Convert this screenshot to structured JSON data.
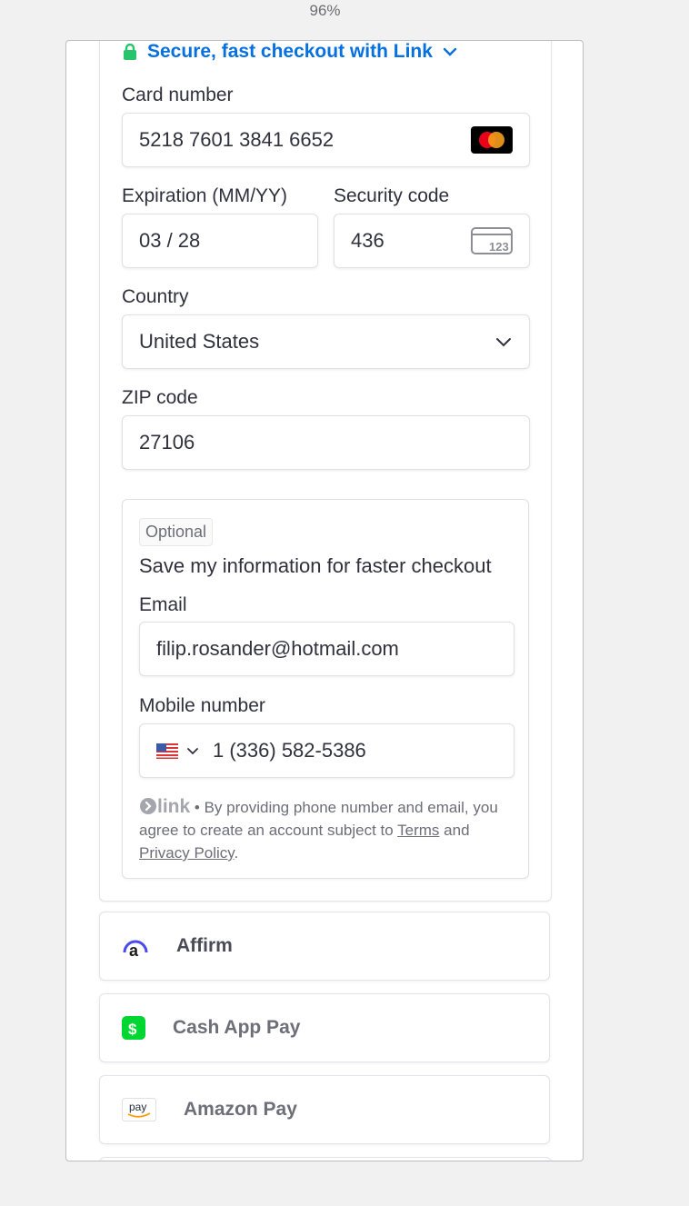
{
  "browser": {
    "zoom": "96%"
  },
  "link": {
    "banner": "Secure, fast checkout with Link"
  },
  "card": {
    "number_label": "Card number",
    "number_value": "5218 7601 3841 6652",
    "expiry_label": "Expiration (MM/YY)",
    "expiry_value": "03 / 28",
    "cvc_label": "Security code",
    "cvc_value": "436",
    "cvc_icon_text": "123",
    "country_label": "Country",
    "country_value": "United States",
    "zip_label": "ZIP code",
    "zip_value": "27106"
  },
  "save": {
    "optional": "Optional",
    "title": "Save my information for faster checkout",
    "email_label": "Email",
    "email_value": "filip.rosander@hotmail.com",
    "mobile_label": "Mobile number",
    "mobile_value": "1 (336) 582-5386",
    "legal_brand": "link",
    "legal_prefix": " • By providing phone number and email, you agree to create an account subject to ",
    "terms": "Terms",
    "and": " and ",
    "privacy": "Privacy Policy",
    "end": "."
  },
  "payment_methods": [
    {
      "name": "Affirm",
      "icon": "affirm-icon"
    },
    {
      "name": "Cash App Pay",
      "icon": "cash-app-icon"
    },
    {
      "name": "Amazon Pay",
      "icon": "amazon-pay-icon",
      "icon_text": "pay"
    }
  ],
  "colors": {
    "link_blue": "#0570de",
    "lock_green": "#33ddb3",
    "affirm_blue": "#4a4af4",
    "cashapp_green": "#00d632"
  }
}
